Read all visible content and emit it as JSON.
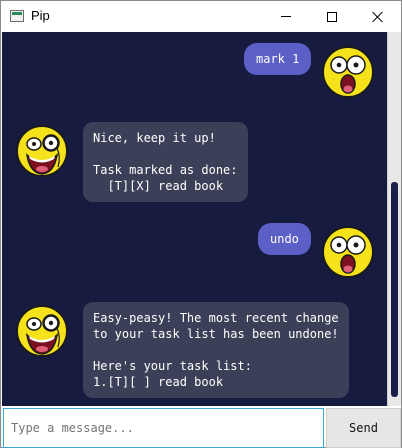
{
  "window": {
    "title": "Pip"
  },
  "messages": [
    {
      "sender": "user",
      "text": "mark 1"
    },
    {
      "sender": "bot",
      "text": "Nice, keep it up!\n\nTask marked as done:\n  [T][X] read book"
    },
    {
      "sender": "user",
      "text": "undo"
    },
    {
      "sender": "bot",
      "text": "Easy-peasy! The most recent change\nto your task list has been undone!\n\nHere's your task list:\n1.[T][ ] read book"
    }
  ],
  "input": {
    "value": "",
    "placeholder": "Type a message..."
  },
  "send_label": "Send",
  "colors": {
    "chat_background": "#161b3f",
    "user_bubble": "#5b5fc6",
    "bot_bubble": "#3b4058",
    "input_focus": "#3aa6d8"
  },
  "icons": {
    "user_avatar": "surprised-face-icon",
    "bot_avatar": "monocle-face-icon"
  }
}
